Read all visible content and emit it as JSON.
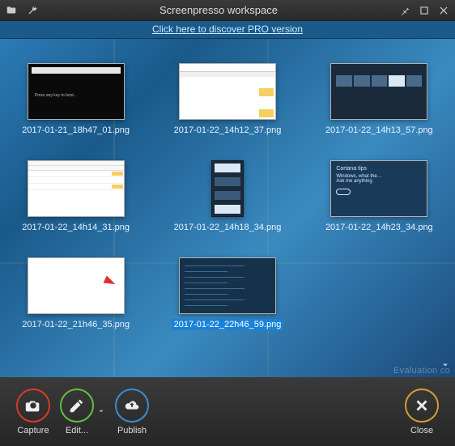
{
  "title": "Screenpresso workspace",
  "promo_text": "Click here to discover PRO version",
  "eval_watermark": "Evaluation co",
  "thumbnails": [
    {
      "filename": "2017-01-21_18h47_01.png",
      "kind": "black",
      "selected": false
    },
    {
      "filename": "2017-01-22_14h12_37.png",
      "kind": "tm",
      "selected": false
    },
    {
      "filename": "2017-01-22_14h13_57.png",
      "kind": "dark",
      "selected": false
    },
    {
      "filename": "2017-01-22_14h14_31.png",
      "kind": "tm2",
      "selected": false
    },
    {
      "filename": "2017-01-22_14h18_34.png",
      "kind": "narrow",
      "selected": false
    },
    {
      "filename": "2017-01-22_14h23_34.png",
      "kind": "cortana",
      "selected": false
    },
    {
      "filename": "2017-01-22_21h46_35.png",
      "kind": "vs",
      "selected": false
    },
    {
      "filename": "2017-01-22_22h46_59.png",
      "kind": "code",
      "selected": true
    }
  ],
  "toolbar": {
    "capture": "Capture",
    "edit": "Edit...",
    "publish": "Publish",
    "close": "Close"
  }
}
